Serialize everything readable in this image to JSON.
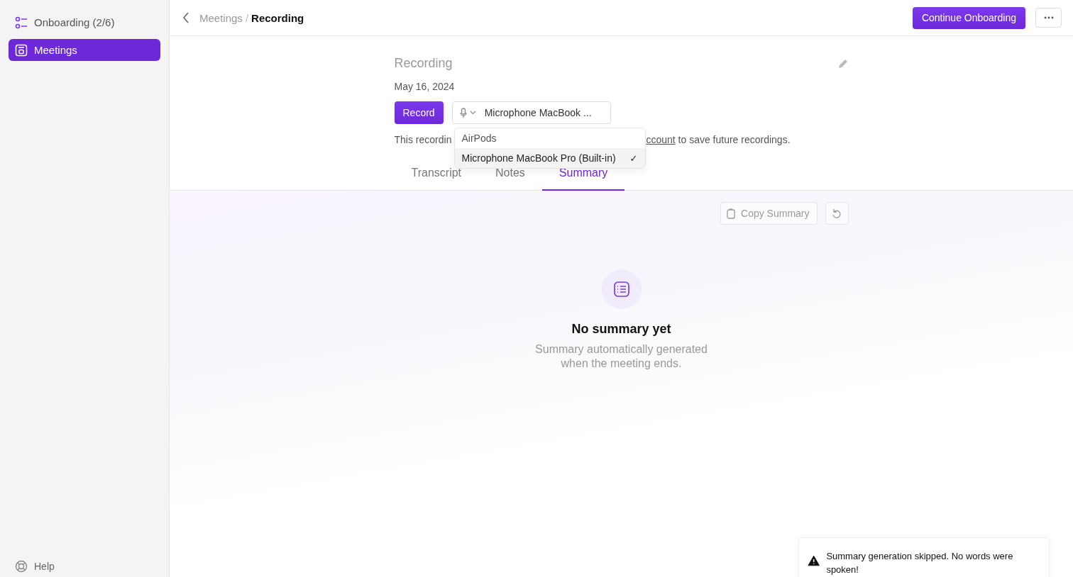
{
  "sidebar": {
    "items": [
      {
        "label": "Onboarding (2/6)",
        "kind": "checklist",
        "selected": false
      },
      {
        "label": "Meetings",
        "kind": "calendar",
        "selected": true
      }
    ],
    "help": "Help"
  },
  "header": {
    "breadcrumb_parent": "Meetings",
    "separator": "/",
    "breadcrumb_current": "Recording",
    "primary_button": "Continue Onboarding"
  },
  "meeting": {
    "title_placeholder": "Recording",
    "date": "May 16, 2024",
    "record_button": "Record",
    "microphone": "Microphone MacBook ...",
    "dropdown": [
      {
        "label": "AirPods",
        "selected": false
      },
      {
        "label": "Microphone MacBook Pro (Built-in)",
        "selected": true
      }
    ],
    "check_mark": "✓",
    "notice_start": "This recordin",
    "notice_link": "ccount",
    "notice_end": " to save future recordings."
  },
  "tabs": [
    {
      "label": "Transcript",
      "selected": false
    },
    {
      "label": "Notes",
      "selected": false
    },
    {
      "label": "Summary",
      "selected": true
    }
  ],
  "summary": {
    "copy_button": "Copy Summary",
    "empty_title": "No summary yet",
    "empty_text": "Summary automatically generated when the meeting ends."
  },
  "toast": {
    "message": "Summary generation skipped. No words were spoken!"
  }
}
